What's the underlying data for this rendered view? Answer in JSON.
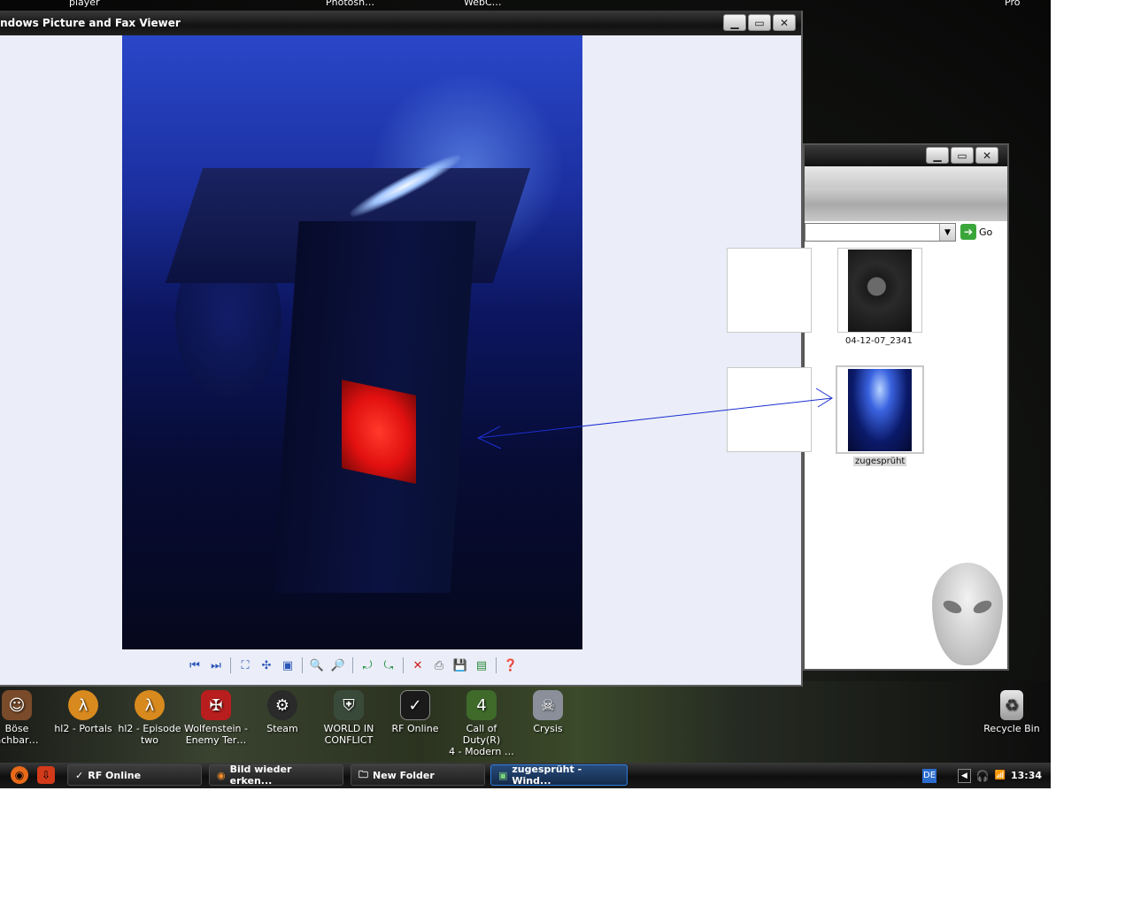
{
  "desktop": {
    "top_labels": [
      "player",
      "Photosh…",
      "WebC…",
      "Pro"
    ],
    "icons": [
      {
        "label": "Böse\nachbar…",
        "icon": "game-icon"
      },
      {
        "label": "hl2 - Portals",
        "icon": "half-life-icon"
      },
      {
        "label": "hl2 - Episode\ntwo",
        "icon": "half-life-icon"
      },
      {
        "label": "Wolfenstein -\nEnemy Ter…",
        "icon": "wolfenstein-icon"
      },
      {
        "label": "Steam",
        "icon": "steam-icon"
      },
      {
        "label": "WORLD IN\nCONFLICT",
        "icon": "shield-icon"
      },
      {
        "label": "RF Online",
        "icon": "rf-online-icon"
      },
      {
        "label": "Call of Duty(R)\n4 - Modern …",
        "icon": "call-of-duty-icon"
      },
      {
        "label": "Crysis",
        "icon": "crysis-icon"
      }
    ],
    "recycle_bin": "Recycle Bin"
  },
  "viewer": {
    "title": "indows Picture and Fax Viewer",
    "toolbar_icons": [
      "previous-icon",
      "next-icon",
      "best-fit-icon",
      "actual-size-icon",
      "slideshow-icon",
      "zoom-in-icon",
      "zoom-out-icon",
      "rotate-clockwise-icon",
      "rotate-counterclockwise-icon",
      "delete-icon",
      "print-icon",
      "save-icon",
      "edit-icon",
      "help-icon"
    ]
  },
  "folder": {
    "go_label": "Go",
    "items": [
      {
        "label": "04-12-07_2341"
      },
      {
        "label": "zugesprüht",
        "selected": true
      }
    ]
  },
  "taskbar": {
    "buttons": [
      {
        "label": "RF Online",
        "icon": "rf-online-icon"
      },
      {
        "label": "Bild wieder erken...",
        "icon": "firefox-icon"
      },
      {
        "label": "New Folder",
        "icon": "folder-icon"
      },
      {
        "label": "zugesprüht - Wind...",
        "icon": "picture-viewer-icon",
        "active": true
      }
    ],
    "language": "DE",
    "clock": "13:34"
  }
}
